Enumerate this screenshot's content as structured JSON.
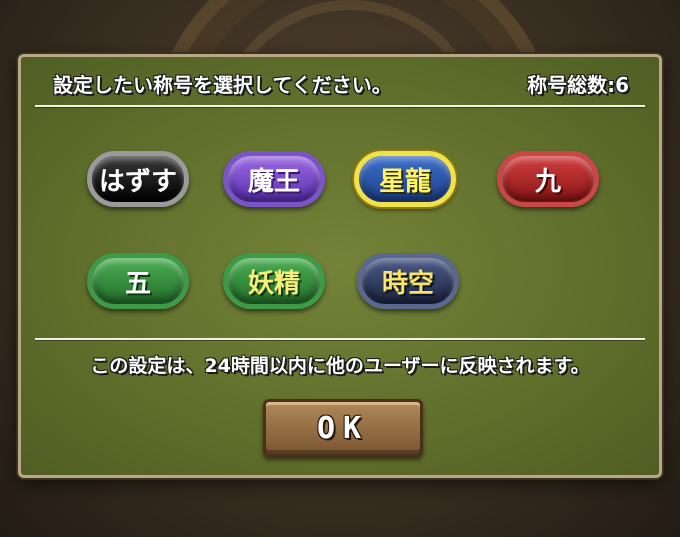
{
  "dialog": {
    "prompt": "設定したい称号を選択してください。",
    "count_text": "称号総数:6",
    "notice": "この設定は、24時間以内に他のユーザーに反映されます。",
    "ok_label": "OK"
  },
  "titles": [
    {
      "label": "はずす",
      "style": "black"
    },
    {
      "label": "魔王",
      "style": "purple"
    },
    {
      "label": "星龍",
      "style": "blue",
      "selected": true
    },
    {
      "label": "九",
      "style": "red"
    },
    {
      "label": "五",
      "style": "green"
    },
    {
      "label": "妖精",
      "style": "green-yellow"
    },
    {
      "label": "時空",
      "style": "navy"
    }
  ]
}
